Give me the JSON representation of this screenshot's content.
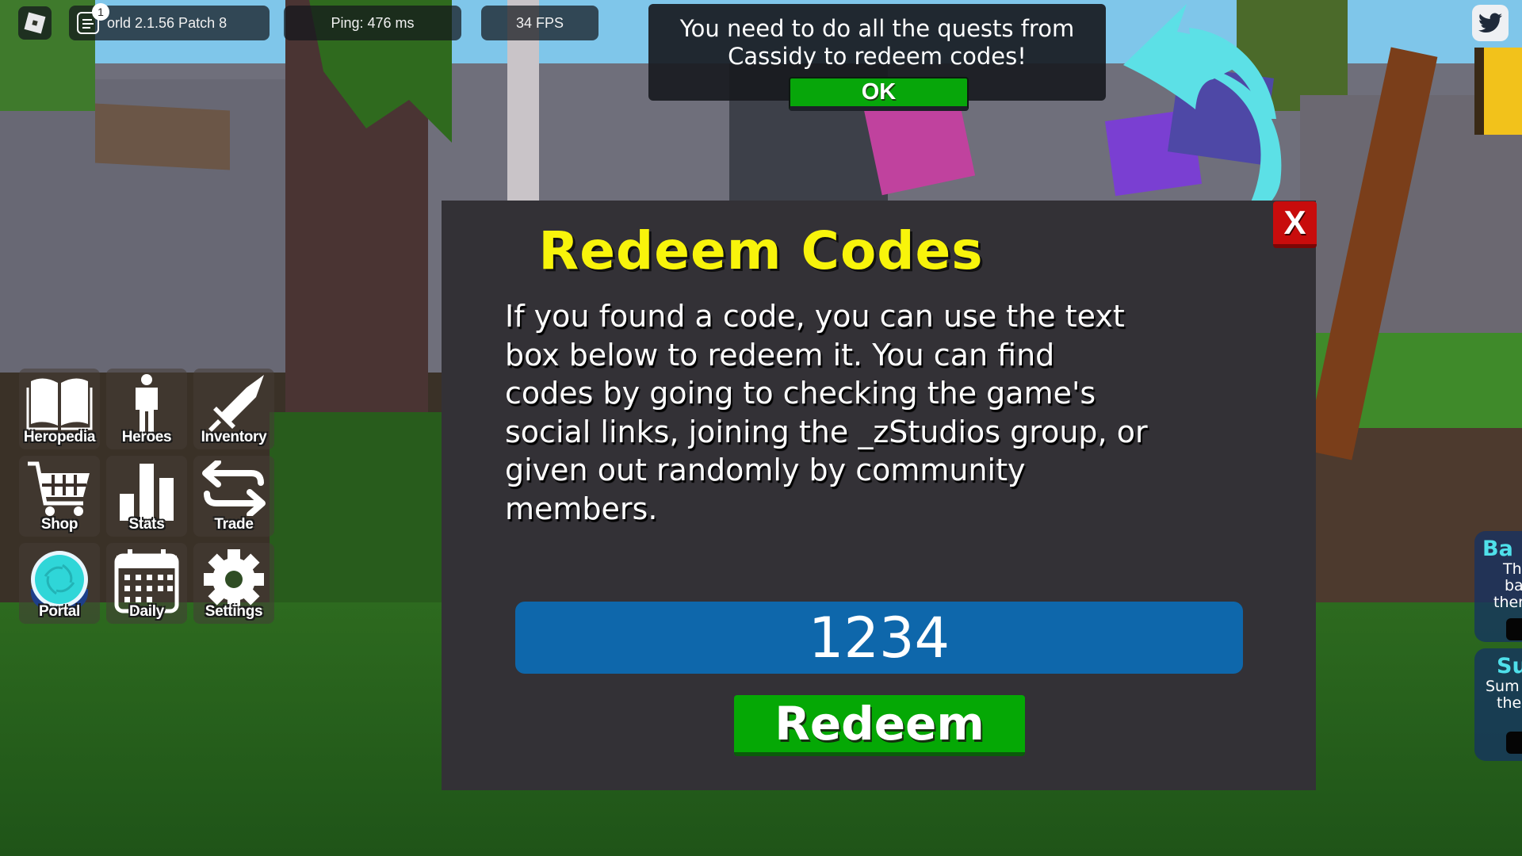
{
  "topbar": {
    "roblox_menu_icon": "roblox-logo-icon",
    "chat_icon": "chat-icon",
    "chat_badge_count": "1",
    "version_text": "orld 2.1.56 Patch 8",
    "ping_text": "Ping: 476 ms",
    "fps_text": "34 FPS",
    "twitter_icon": "twitter-bird-icon"
  },
  "notification": {
    "message": "You need to do all the quests from\nCassidy to redeem codes!",
    "ok_label": "OK"
  },
  "menu": {
    "items": [
      {
        "label": "Heropedia",
        "icon": "book-icon"
      },
      {
        "label": "Heroes",
        "icon": "person-icon"
      },
      {
        "label": "Inventory",
        "icon": "sword-icon"
      },
      {
        "label": "Shop",
        "icon": "cart-icon"
      },
      {
        "label": "Stats",
        "icon": "bar-chart-icon"
      },
      {
        "label": "Trade",
        "icon": "swap-arrows-icon"
      },
      {
        "label": "Portal",
        "icon": "portal-icon"
      },
      {
        "label": "Daily",
        "icon": "calendar-icon"
      },
      {
        "label": "Settings",
        "icon": "gear-icon"
      }
    ]
  },
  "side_cards": [
    {
      "title": "Ba",
      "lines": [
        "Th",
        "ba",
        "ther"
      ]
    },
    {
      "title": "Su",
      "lines": [
        "Sum",
        "the"
      ]
    }
  ],
  "redeem_panel": {
    "title": "Redeem Codes",
    "body": "If you found a code, you can use the text\nbox below to redeem it.  You can find\ncodes by going to checking the game's\nsocial links, joining the _zStudios group, or\ngiven out randomly by community\nmembers.",
    "close_label": "X",
    "code_value": "1234",
    "redeem_label": "Redeem"
  },
  "colors": {
    "title_yellow": "#f8f40b",
    "panel_bg": "#333136",
    "input_blue": "#0e67ab",
    "button_green": "#05a805",
    "close_red": "#c80c0c",
    "arrow_cyan": "#5ce0e6"
  }
}
